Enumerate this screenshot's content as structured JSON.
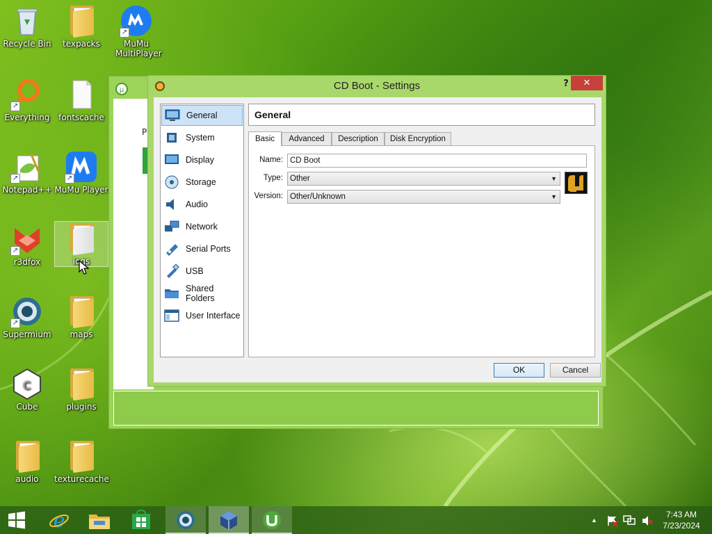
{
  "desktop": {
    "icons": [
      {
        "label": "Recycle Bin"
      },
      {
        "label": "texpacks"
      },
      {
        "label": "MuMu MultiPlayer"
      },
      {
        "label": "Everything"
      },
      {
        "label": "fontscache"
      },
      {
        "label": "Notepad++"
      },
      {
        "label": "MuMu Player"
      },
      {
        "label": "r3dfox"
      },
      {
        "label": "logs"
      },
      {
        "label": "Supermium"
      },
      {
        "label": "maps"
      },
      {
        "label": "Cube"
      },
      {
        "label": "plugins"
      },
      {
        "label": "audio"
      },
      {
        "label": "texturecache"
      }
    ]
  },
  "background_window": {
    "partial_text": "Pl"
  },
  "dialog": {
    "title": "CD Boot - Settings",
    "help_label": "?",
    "close_label": "✕",
    "nav": [
      {
        "label": "General",
        "icon": "monitor-icon"
      },
      {
        "label": "System",
        "icon": "chip-icon"
      },
      {
        "label": "Display",
        "icon": "display-icon"
      },
      {
        "label": "Storage",
        "icon": "disk-icon"
      },
      {
        "label": "Audio",
        "icon": "speaker-icon"
      },
      {
        "label": "Network",
        "icon": "network-icon"
      },
      {
        "label": "Serial Ports",
        "icon": "serial-port-icon"
      },
      {
        "label": "USB",
        "icon": "usb-icon"
      },
      {
        "label": "Shared Folders",
        "icon": "folder-icon"
      },
      {
        "label": "User Interface",
        "icon": "window-icon"
      }
    ],
    "selected_nav": "General",
    "section_title": "General",
    "tabs": [
      "Basic",
      "Advanced",
      "Description",
      "Disk Encryption"
    ],
    "active_tab": "Basic",
    "fields": {
      "name_label": "Name:",
      "name_value": "CD Boot",
      "type_label": "Type:",
      "type_value": "Other",
      "version_label": "Version:",
      "version_value": "Other/Unknown"
    },
    "buttons": {
      "ok": "OK",
      "cancel": "Cancel"
    }
  },
  "taskbar": {
    "clock_time": "7:43 AM",
    "clock_date": "7/23/2024",
    "tray_chevron": "▲"
  },
  "colors": {
    "accent_green": "#a8d86a",
    "selection_blue": "#cde3f8",
    "close_red": "#c7403a"
  }
}
